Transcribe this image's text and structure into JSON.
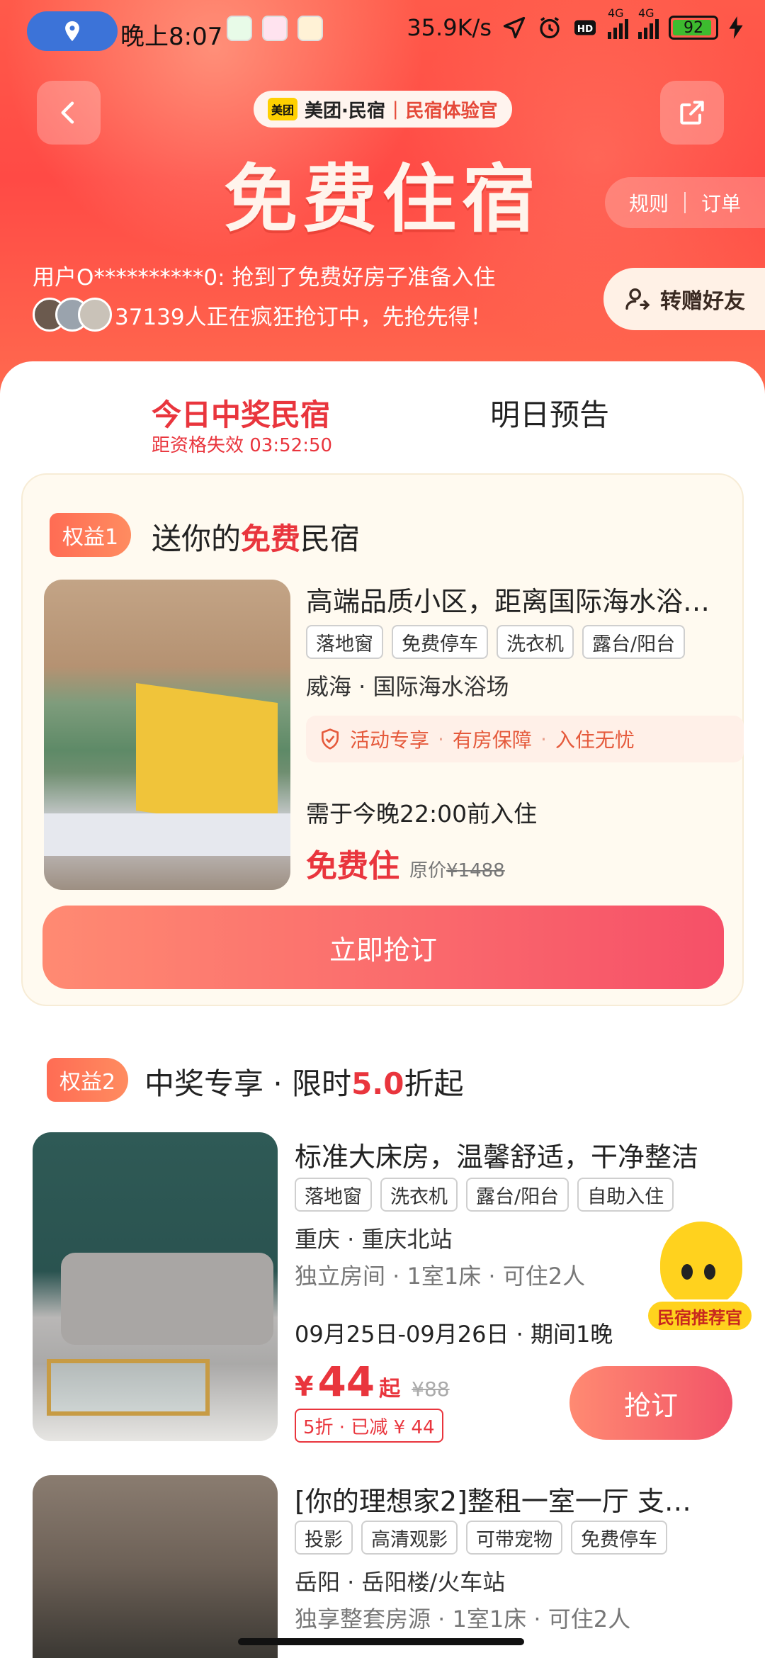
{
  "status_bar": {
    "time": "晚上8:07",
    "net_speed": "35.9K/s",
    "net_type_1": "4G",
    "net_type_2": "4G",
    "battery": "92"
  },
  "header": {
    "brand_logo": "美团",
    "brand_name": "美团·民宿",
    "brand_sep": "|",
    "brand_tag": "民宿体验官",
    "title": "免费住宿",
    "rules_label": "规则",
    "orders_label": "订单",
    "gift_label": "转赠好友",
    "ticker": "用户O**********0: 抢到了免费好房子准备入住",
    "crowd_text": "37139人正在疯狂抢订中，先抢先得！"
  },
  "tabs": {
    "today": "今日中奖民宿",
    "tomorrow": "明日预告",
    "countdown": "距资格失效 03:52:50"
  },
  "benefit1": {
    "badge": "权益1",
    "title_prefix": "送你的",
    "title_highlight": "免费",
    "title_suffix": "民宿",
    "listing": {
      "name": "高端品质小区，距离国际海水浴…",
      "tags": [
        "落地窗",
        "免费停车",
        "洗衣机",
        "露台/阳台"
      ],
      "location": "威海 · 国际海水浴场",
      "guarantee": [
        "活动专享",
        "有房保障",
        "入住无忧"
      ],
      "checkin_note": "需于今晚22:00前入住",
      "free_label": "免费住",
      "orig_label": "原价",
      "orig_price": "¥1488"
    },
    "button": "立即抢订"
  },
  "benefit2": {
    "badge": "权益2",
    "title_prefix": "中奖专享 · 限时",
    "title_highlight": "5.0",
    "title_suffix": "折起",
    "listings": [
      {
        "name": "标准大床房，温馨舒适，干净整洁",
        "tags": [
          "落地窗",
          "洗衣机",
          "露台/阳台",
          "自助入住"
        ],
        "location": "重庆 · 重庆北站",
        "room": "独立房间 · 1室1床 · 可住2人",
        "dates": "09月25日-09月26日 · 期间1晚",
        "price_symbol": "¥",
        "price": "44",
        "price_suffix": "起",
        "orig_price": "¥88",
        "discount": "5折 · 已减 ¥ 44",
        "button": "抢订"
      },
      {
        "name": "[你的理想家2]整租一室一厅 支…",
        "tags": [
          "投影",
          "高清观影",
          "可带宠物",
          "免费停车"
        ],
        "location": "岳阳 · 岳阳楼/火车站",
        "room": "独享整套房源 · 1室1床 · 可住2人"
      }
    ]
  },
  "mascot": {
    "label": "民宿推荐官"
  },
  "colors": {
    "accent_red": "#e9353d",
    "hero_bg": "#ff4a45",
    "badge_orange": "#ff7a5a"
  }
}
